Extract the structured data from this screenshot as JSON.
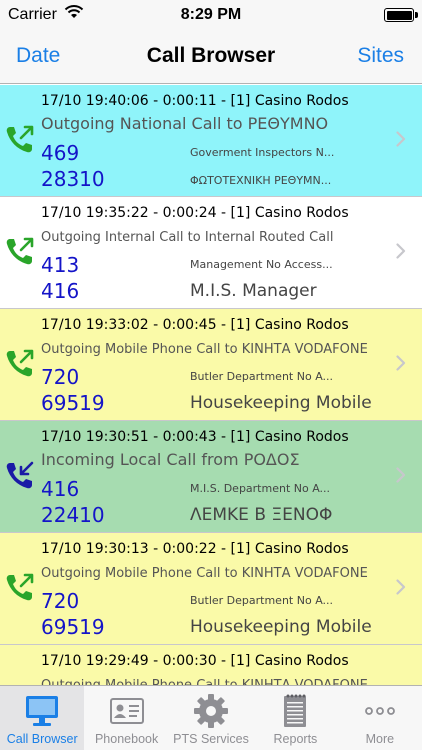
{
  "status_bar": {
    "carrier": "Carrier",
    "time": "8:29 PM"
  },
  "nav": {
    "left": "Date",
    "title": "Call Browser",
    "right": "Sites"
  },
  "colors": {
    "outgoing_icon": "#2aa52a",
    "incoming_icon": "#1a1aa6",
    "accent": "#1a7fe6",
    "number": "#1414c8"
  },
  "calls": [
    {
      "header": "17/10 19:40:06 - 0:00:11 - [1] Casino Rodos",
      "description": "Outgoing National Call to ΡΕΘΥΜΝΟ",
      "extension": "469",
      "extension_desc": "Goverment Inspectors N...",
      "number": "28310",
      "number_desc": "ΦΩΤΟΤΕΧΝΙΚΗ ΡΕΘΥΜΝ...",
      "direction_icon": "outgoing-call-icon",
      "bg": "#8ff4fa"
    },
    {
      "header": "17/10 19:35:22 - 0:00:24 - [1] Casino Rodos",
      "description": "Outgoing Internal Call to Internal Routed Call",
      "extension": "413",
      "extension_desc": "Management No Access...",
      "number": "416",
      "number_desc": "M.I.S. Manager",
      "direction_icon": "outgoing-call-icon",
      "bg": "#ffffff"
    },
    {
      "header": "17/10 19:33:02 - 0:00:45 - [1] Casino Rodos",
      "description": "Outgoing Mobile Phone Call to ΚΙΝΗΤΑ VODAFONE",
      "extension": "720",
      "extension_desc": "Butler Department No A...",
      "number": "69519",
      "number_desc": "Housekeeping Mobile",
      "direction_icon": "outgoing-call-icon",
      "bg": "#fafaa8"
    },
    {
      "header": "17/10 19:30:51 - 0:00:43 - [1] Casino Rodos",
      "description": "Incoming Local Call from ΡΟΔΟΣ",
      "extension": "416",
      "extension_desc": "M.I.S. Department No A...",
      "number": "22410",
      "number_desc": "ΛΕΜΚΕ Β ΞΕΝΟΦ",
      "direction_icon": "incoming-call-icon",
      "bg": "#a6dcb0"
    },
    {
      "header": "17/10 19:30:13 - 0:00:22 - [1] Casino Rodos",
      "description": "Outgoing Mobile Phone Call to ΚΙΝΗΤΑ VODAFONE",
      "extension": "720",
      "extension_desc": "Butler Department No A...",
      "number": "69519",
      "number_desc": "Housekeeping Mobile",
      "direction_icon": "outgoing-call-icon",
      "bg": "#fafaa8"
    },
    {
      "header": "17/10 19:29:49 - 0:00:30 - [1] Casino Rodos",
      "description": "Outgoing Mobile Phone Call to ΚΙΝΗΤΑ VODAFONE",
      "extension": "",
      "extension_desc": "",
      "number": "",
      "number_desc": "",
      "direction_icon": "outgoing-call-icon",
      "bg": "#fafaa8"
    }
  ],
  "tabs": [
    {
      "label": "Call Browser",
      "icon": "monitor-icon",
      "active": true
    },
    {
      "label": "Phonebook",
      "icon": "contact-card-icon",
      "active": false
    },
    {
      "label": "PTS Services",
      "icon": "gear-icon",
      "active": false
    },
    {
      "label": "Reports",
      "icon": "report-notepad-icon",
      "active": false
    },
    {
      "label": "More",
      "icon": "more-dots-icon",
      "active": false
    }
  ]
}
